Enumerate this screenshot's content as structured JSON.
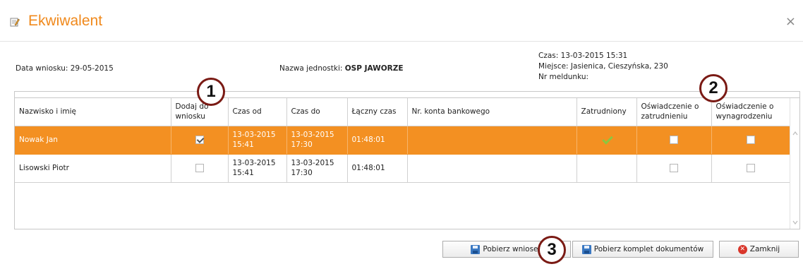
{
  "window": {
    "title": "Ekwiwalent",
    "close_glyph": "×"
  },
  "info": {
    "date_label": "Data wniosku: 29-05-2015",
    "unit_label": "Nazwa jednostki: ",
    "unit_value": "OSP JAWORZE",
    "time": "Czas: 13-03-2015 15:31",
    "place": "Miejsce: Jasienica, Cieszyńska, 230",
    "report_no": "Nr meldunku:"
  },
  "grid": {
    "headers": {
      "name": "Nazwisko i imię",
      "add_to_request": "Dodaj do wniosku",
      "time_from": "Czas od",
      "time_to": "Czas do",
      "total_time": "Łączny czas",
      "bank_account": "Nr. konta bankowego",
      "employed": "Zatrudniony",
      "employment_statement": "Oświadczenie o zatrudnieniu",
      "salary_statement": "Oświadczenie o wynagrodzeniu"
    },
    "rows": [
      {
        "name": "Nowak Jan",
        "add_to_request": true,
        "time_from_date": "13-03-2015",
        "time_from_hour": "15:41",
        "time_to_date": "13-03-2015",
        "time_to_hour": "17:30",
        "total_time": "01:48:01",
        "bank_account": "",
        "employed": true,
        "employment_statement": false,
        "salary_statement": false,
        "selected": true
      },
      {
        "name": "Lisowski Piotr",
        "add_to_request": false,
        "time_from_date": "13-03-2015",
        "time_from_hour": "15:41",
        "time_to_date": "13-03-2015",
        "time_to_hour": "17:30",
        "total_time": "01:48:01",
        "bank_account": "",
        "employed": false,
        "employment_statement": false,
        "salary_statement": false,
        "selected": false
      }
    ]
  },
  "buttons": {
    "download_request": "Pobierz wniosek",
    "download_documents": "Pobierz komplet dokumentów",
    "close": "Zamknij"
  },
  "callouts": [
    "1",
    "2",
    "3"
  ],
  "colors": {
    "accent": "#f0891c",
    "selected_row": "#f39022",
    "callout_border": "#7a1a14",
    "check_green": "#8dc63f"
  }
}
